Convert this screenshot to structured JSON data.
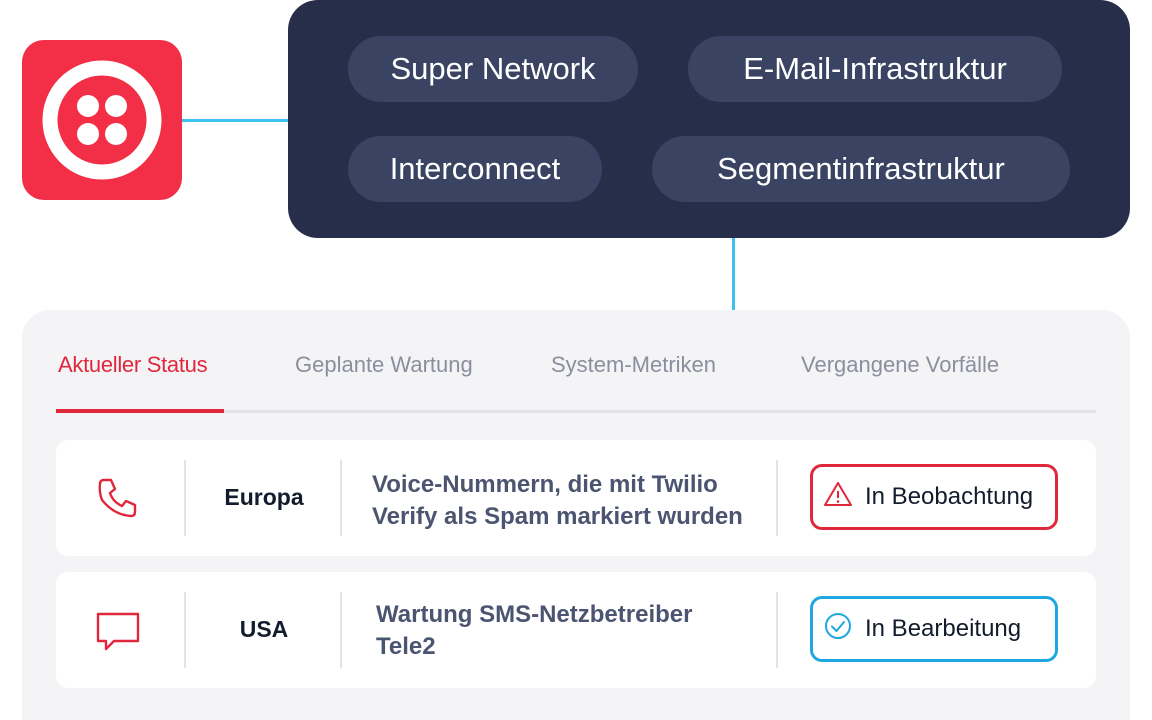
{
  "brand": {
    "logo": "twilio-logo",
    "accent": "#f22f46"
  },
  "infrastructure": {
    "pills": [
      "Super Network",
      "E-Mail-Infrastruktur",
      "Interconnect",
      "Segmentinfrastruktur"
    ]
  },
  "status": {
    "tabs": [
      "Aktueller Status",
      "Geplante Wartung",
      "System-Metriken",
      "Vergangene Vorfälle"
    ],
    "active_tab": "Aktueller Status",
    "incidents": [
      {
        "icon": "phone-icon",
        "region": "Europa",
        "description_line1": "Voice-Nummern, die mit Twilio",
        "description_line2": "Verify als Spam markiert wurden",
        "badge_icon": "warning-icon",
        "badge_label": "In Beobachtung",
        "badge_color": "#e0283c"
      },
      {
        "icon": "message-icon",
        "region": "USA",
        "description_line1": "Wartung SMS-Netzbetreiber",
        "description_line2": "Tele2",
        "badge_icon": "check-circle-icon",
        "badge_label": "In Bearbeitung",
        "badge_color": "#1ea7e1"
      }
    ]
  }
}
